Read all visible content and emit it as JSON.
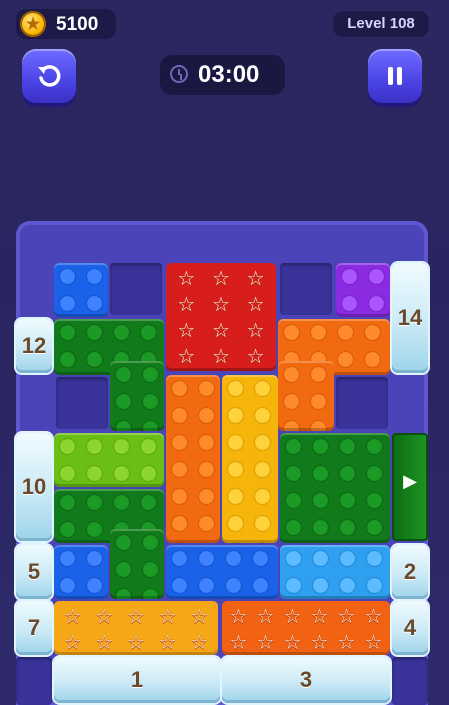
{
  "hud": {
    "coins": "5100",
    "level": "Level 108",
    "timer": "03:00"
  },
  "board": {
    "ice_counters": {
      "left_top": "12",
      "left_mid": "10",
      "left_a": "5",
      "left_b": "7",
      "right_top": "14",
      "right_a": "2",
      "right_b": "4",
      "bottom_left": "1",
      "bottom_right": "3"
    },
    "star_glyph": "☆",
    "exit_arrow": "▶"
  },
  "colors": {
    "blue": "#1a62e8",
    "purple": "#8a2be2",
    "dark_green": "#117a1a",
    "light_green": "#6bbf14",
    "orange": "#f26a10",
    "yellow": "#f5b50a",
    "sky": "#2f9ff0",
    "red": "#d81d1d",
    "board": "#4a44b8"
  }
}
